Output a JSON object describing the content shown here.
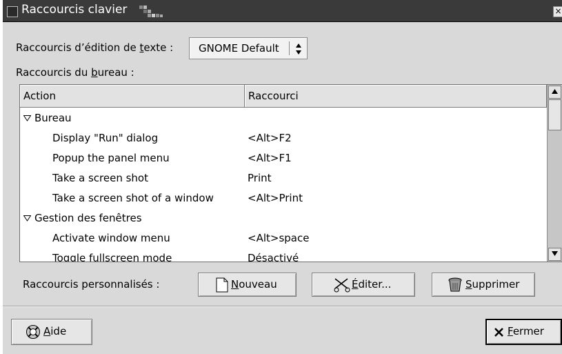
{
  "window": {
    "title": "Raccourcis clavier",
    "close_glyph": "×"
  },
  "text_shortcuts": {
    "label_pre": "Raccourcis d’édition de ",
    "label_mnemonic": "t",
    "label_post": "exte :",
    "selected": "GNOME Default"
  },
  "desktop_shortcuts": {
    "label_pre": "Raccourcis du ",
    "label_mnemonic": "b",
    "label_post": "ureau :"
  },
  "tree": {
    "columns": [
      "Action",
      "Raccourci"
    ],
    "rows": [
      {
        "action": "Bureau",
        "shortcut": "",
        "group": true
      },
      {
        "action": "Display \"Run\" dialog",
        "shortcut": "<Alt>F2",
        "group": false
      },
      {
        "action": "Popup the panel menu",
        "shortcut": "<Alt>F1",
        "group": false
      },
      {
        "action": "Take a screen shot",
        "shortcut": "Print",
        "group": false
      },
      {
        "action": "Take a screen shot of a window",
        "shortcut": "<Alt>Print",
        "group": false
      },
      {
        "action": "Gestion des fenêtres",
        "shortcut": "",
        "group": true
      },
      {
        "action": "Activate window menu",
        "shortcut": "<Alt>space",
        "group": false
      },
      {
        "action": "Toggle fullscreen mode",
        "shortcut": "Désactivé",
        "group": false
      }
    ]
  },
  "custom": {
    "label": "Raccourcis personnalisés :",
    "new": {
      "mnemonic": "N",
      "rest": "ouveau"
    },
    "edit": {
      "mnemonic": "É",
      "rest": "diter..."
    },
    "delete": {
      "mnemonic": "S",
      "rest": "upprimer"
    }
  },
  "footer": {
    "help": {
      "mnemonic": "A",
      "rest": "ide"
    },
    "close": {
      "mnemonic": "F",
      "rest": "ermer"
    }
  }
}
